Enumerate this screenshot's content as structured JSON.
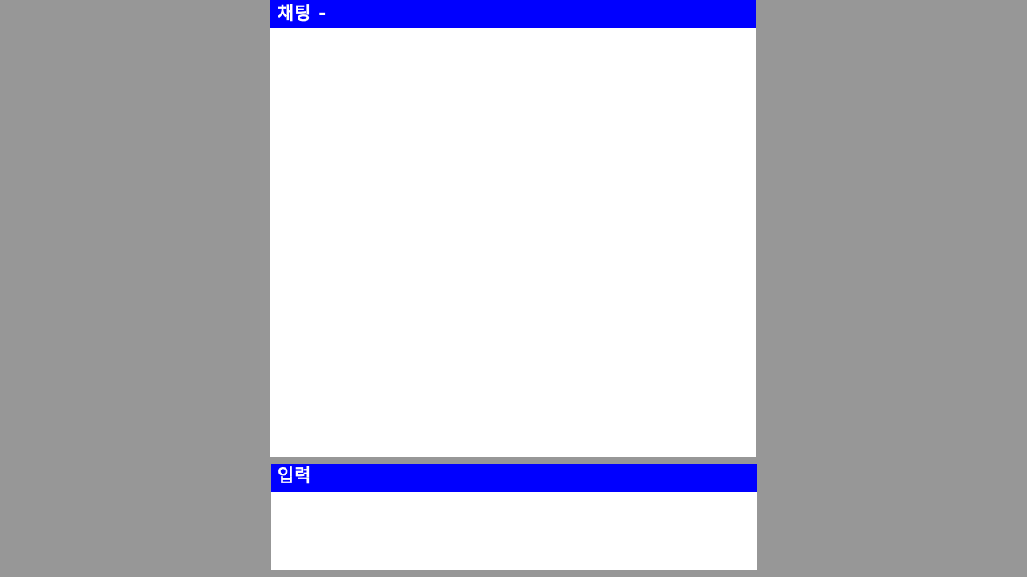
{
  "chat_panel": {
    "title": "채팅 -"
  },
  "input_panel": {
    "title": "입력",
    "value": ""
  },
  "colors": {
    "background": "#979797",
    "header": "#0000ff",
    "header_text": "#ffffff",
    "panel": "#ffffff"
  }
}
